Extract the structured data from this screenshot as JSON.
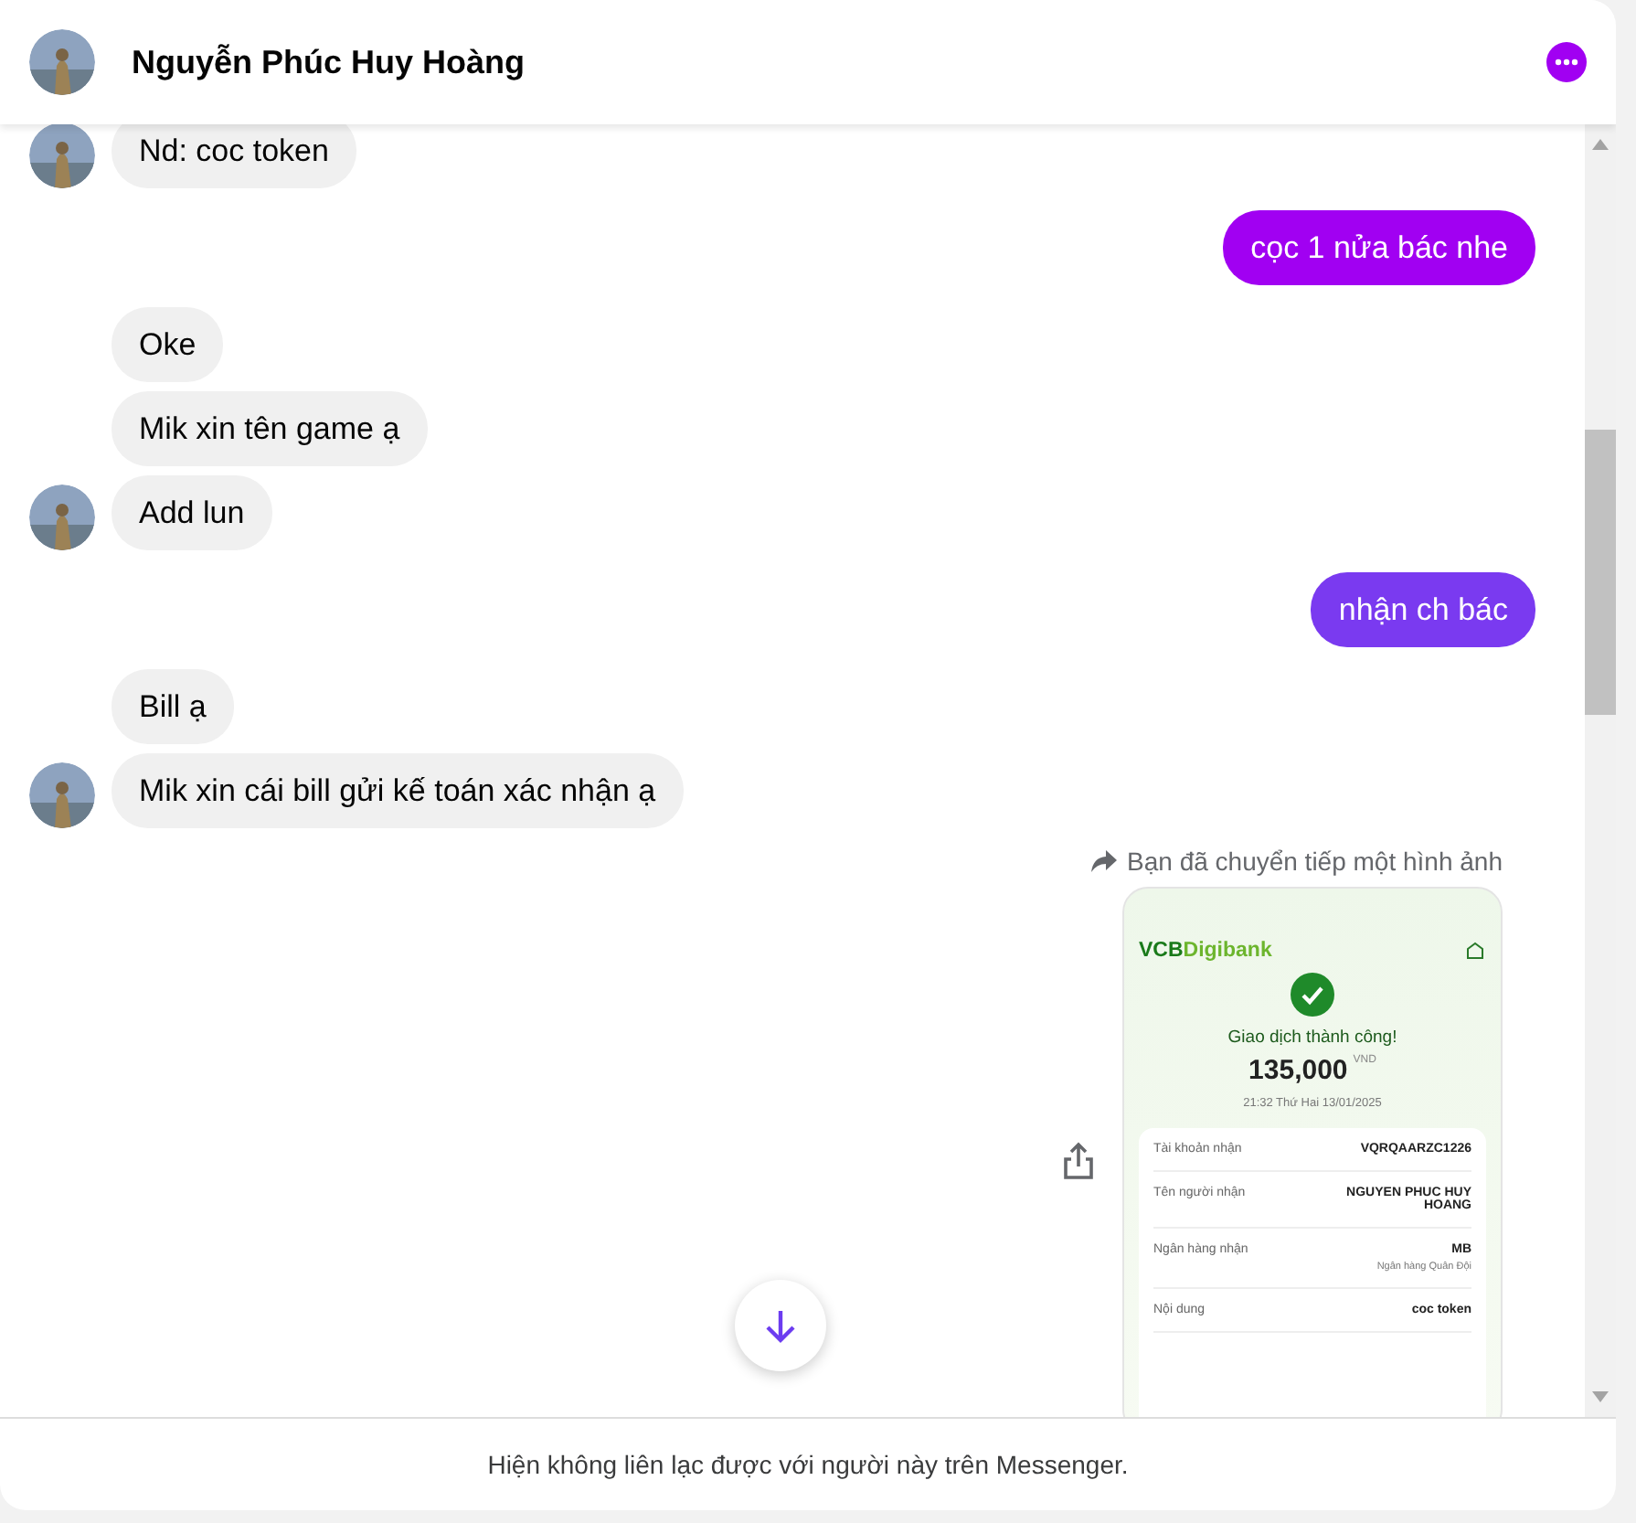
{
  "header": {
    "name": "Nguyễn Phúc Huy Hoàng"
  },
  "messages": [
    {
      "kind": "incoming",
      "text": "Nd: coc token",
      "avatar": true
    },
    {
      "kind": "outgoing",
      "text": "cọc 1 nửa bác nhe",
      "color": "#a100f2"
    },
    {
      "kind": "incoming",
      "text": "Oke",
      "avatar": false
    },
    {
      "kind": "incoming",
      "text": "Mik xin tên game ạ",
      "avatar": false
    },
    {
      "kind": "incoming",
      "text": "Add lun",
      "avatar": true
    },
    {
      "kind": "outgoing",
      "text": "nhận ch bác",
      "color": "#7a3af0"
    },
    {
      "kind": "incoming",
      "text": "Bill ạ",
      "avatar": false
    },
    {
      "kind": "incoming",
      "text": "Mik xin cái bill gửi kế toán xác nhận ạ",
      "avatar": true
    },
    {
      "kind": "forwarded_image",
      "note": "Bạn đã chuyển tiếp một hình ảnh",
      "receipt": {
        "bank": "VCB",
        "bank_suffix": "Digibank",
        "status": "Giao dịch thành công!",
        "amount": "135,000",
        "currency": "VND",
        "datetime": "21:32 Thứ Hai 13/01/2025",
        "rows": [
          {
            "label": "Tài khoản nhận",
            "value": "VQRQAARZC1226"
          },
          {
            "label": "Tên người nhận",
            "value": "NGUYEN PHUC HUY HOANG"
          },
          {
            "label": "Ngân hàng nhận",
            "value": "MB",
            "subvalue": "Ngân hàng Quân Đội"
          },
          {
            "label": "Nội dung",
            "value": "coc token"
          }
        ]
      }
    }
  ],
  "footer": "Hiện không liên lạc được với người này trên Messenger."
}
